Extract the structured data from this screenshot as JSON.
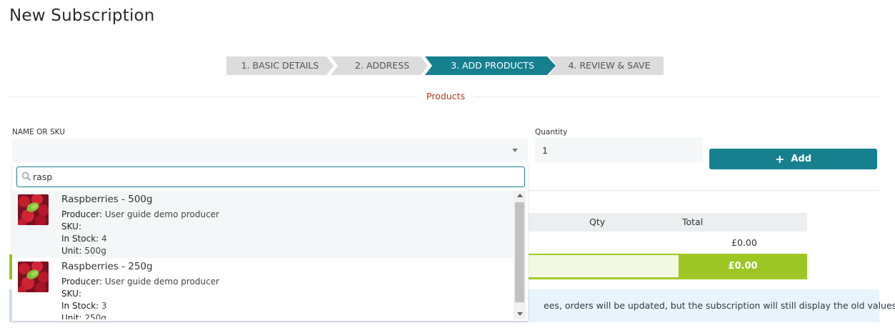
{
  "page": {
    "title": "New Subscription"
  },
  "wizard": {
    "steps": [
      {
        "label": "1. BASIC DETAILS",
        "active": false
      },
      {
        "label": "2. ADDRESS",
        "active": false
      },
      {
        "label": "3. ADD PRODUCTS",
        "active": true
      },
      {
        "label": "4. REVIEW & SAVE",
        "active": false
      }
    ],
    "colors": {
      "active": "#16808f",
      "inactive": "#dcdcdc"
    }
  },
  "section": {
    "title": "Products"
  },
  "form": {
    "name_label": "NAME OR SKU",
    "quantity_label": "Quantity",
    "quantity_value": "1",
    "add_label": "Add"
  },
  "search": {
    "value": "rasp"
  },
  "results": [
    {
      "name": "Raspberries - 500g",
      "producer_label": "Producer:",
      "producer": "User guide demo producer",
      "sku_label": "SKU:",
      "sku": "",
      "stock_label": "In Stock:",
      "stock": "4",
      "unit_label": "Unit:",
      "unit": "500g"
    },
    {
      "name": "Raspberries - 250g",
      "producer_label": "Producer:",
      "producer": "User guide demo producer",
      "sku_label": "SKU:",
      "sku": "",
      "stock_label": "In Stock:",
      "stock": "3",
      "unit_label": "Unit:",
      "unit": "250g"
    }
  ],
  "table": {
    "headers": {
      "qty": "Qty",
      "total": "Total"
    },
    "row_total": "£0.00",
    "grand_total": "£0.00"
  },
  "info": {
    "text": "ees, orders will be updated, but the subscription will still display the old values."
  },
  "colors": {
    "teal": "#16808f",
    "green": "#9cc624",
    "section_title": "#b03a1c"
  }
}
